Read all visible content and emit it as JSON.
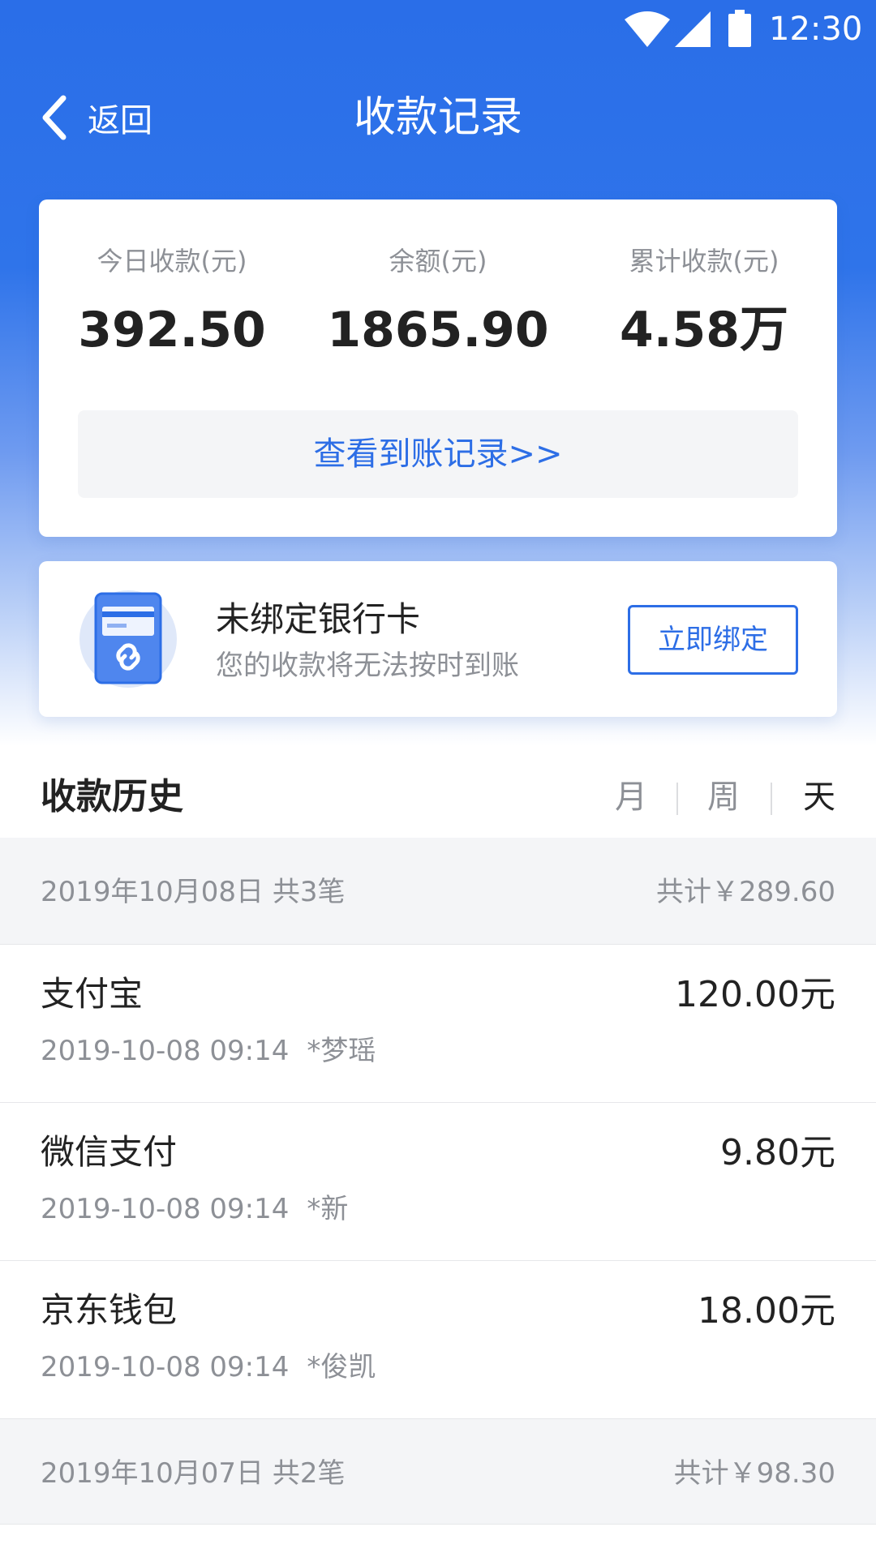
{
  "status_bar": {
    "time": "12:30"
  },
  "nav": {
    "back_label": "返回",
    "title": "收款记录"
  },
  "stats": {
    "today_label": "今日收款(元)",
    "today_value": "392.50",
    "balance_label": "余额(元)",
    "balance_value": "1865.90",
    "total_label": "累计收款(元)",
    "total_value": "4.58万",
    "records_link": "查看到账记录>>"
  },
  "bank": {
    "title": "未绑定银行卡",
    "subtitle": "您的收款将无法按时到账",
    "bind_label": "立即绑定"
  },
  "history": {
    "title": "收款历史",
    "filters": [
      "月",
      "周",
      "天"
    ],
    "active_filter": "天"
  },
  "days": [
    {
      "label": "2019年10月08日 共3笔",
      "total": "共计￥289.60",
      "transactions": [
        {
          "name": "支付宝",
          "time": "2019-10-08 09:14",
          "payer": "*梦瑶",
          "amount": "120.00元"
        },
        {
          "name": "微信支付",
          "time": "2019-10-08 09:14",
          "payer": "*新",
          "amount": "9.80元"
        },
        {
          "name": "京东钱包",
          "time": "2019-10-08 09:14",
          "payer": "*俊凯",
          "amount": "18.00元"
        }
      ]
    },
    {
      "label": "2019年10月07日 共2笔",
      "total": "共计￥98.30",
      "transactions": []
    }
  ],
  "colors": {
    "primary": "#2d6ee6",
    "header_blue": "#2a6ee8",
    "muted": "#8d9096",
    "panel": "#f4f5f7"
  },
  "icons": {
    "back": "chevron-left-icon",
    "wifi": "wifi-icon",
    "signal": "signal-icon",
    "battery": "battery-icon",
    "card_link": "card-link-icon"
  }
}
